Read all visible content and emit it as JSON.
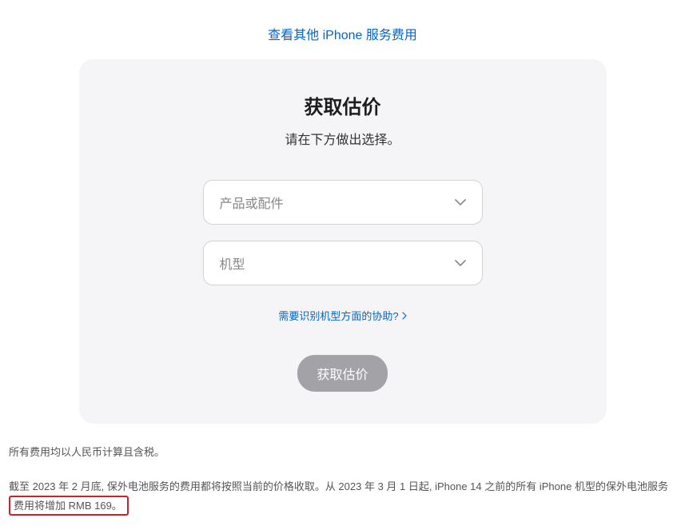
{
  "top_link": "查看其他 iPhone 服务费用",
  "card": {
    "title": "获取估价",
    "subtitle": "请在下方做出选择。",
    "select1_placeholder": "产品或配件",
    "select2_placeholder": "机型",
    "help_link": "需要识别机型方面的协助?",
    "button": "获取估价"
  },
  "footer": {
    "line1": "所有费用均以人民币计算且含税。",
    "line2_part1": "截至 2023 年 2 月底, 保外电池服务的费用都将按照当前的价格收取。从 2023 年 3 月 1 日起, iPhone 14 之前的所有 iPhone 机型的保外电池服务",
    "line2_highlight": "费用将增加 RMB 169。"
  }
}
